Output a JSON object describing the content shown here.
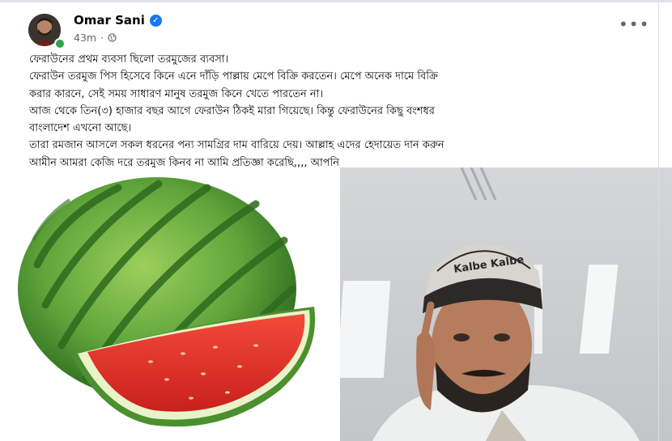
{
  "post": {
    "author": "Omar Sani",
    "time": "43m",
    "privacy_icon": "globe-icon",
    "verified_icon": "verified-badge-icon",
    "more_icon": "more-options-icon",
    "text_lines": [
      "ফেরাউনের প্রথম ব্যবসা ছিলো তরমুজের ব্যবসা।",
      "ফেরাউন তরমুজ পিস হিসেবে কিনে এনে দাঁড়ি পাল্লায় মেপে বিক্রি করতেন। মেপে অনেক দামে বিক্রি",
      "করার কারনে, সেই সময় সাধারণ মানুষ তরমুজ কিনে খেতে পারতেন না।",
      "আজ থেকে তিন(৩) হাজার বছর আগে ফেরাউন ঠিকই মারা গিয়েছে। কিন্তু ফেরাউনের কিছু বংশধর",
      "বাংলাদেশ এখনো আছে।",
      "তারা রমজান আসলে সকল ধরনের পন্য সামগ্রির দাম বারিয়ে দেয়। আল্লাহ এদের হেদায়েত দান করুন",
      "আমীন আমরা কেজি দরে তরমুজ কিনব না আমি প্রতিজ্ঞা করেছি,,,, আপনি"
    ],
    "cap_text": "Kalbe Kalbe"
  },
  "colors": {
    "accent": "#1877f2",
    "secondary_text": "#65676b",
    "watermelon_rind": "#3f8a2c",
    "watermelon_flesh": "#e0322f"
  }
}
